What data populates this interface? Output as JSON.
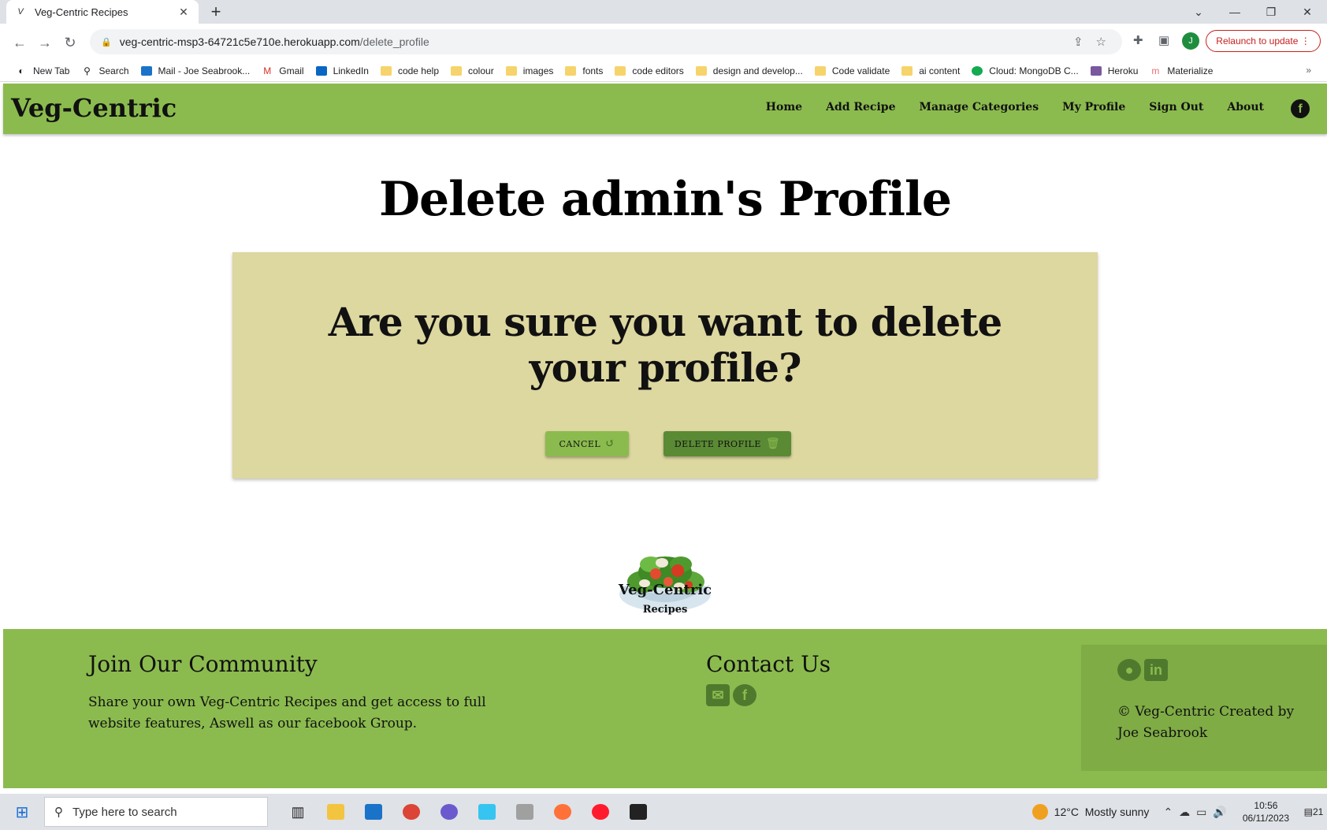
{
  "browser": {
    "tab_title": "Veg-Centric Recipes",
    "tab_favicon": "V",
    "url_host": "veg-centric-msp3-64721c5e710e.herokuapp.com",
    "url_path": "/delete_profile",
    "profile_initial": "J",
    "relaunch_label": "Relaunch to update",
    "bookmarks": [
      {
        "label": "New Tab",
        "icon": "globe-icon"
      },
      {
        "label": "Search",
        "icon": "search-icon"
      },
      {
        "label": "Mail - Joe Seabrook...",
        "icon": "outlook-icon"
      },
      {
        "label": "Gmail",
        "icon": "gmail-icon"
      },
      {
        "label": "LinkedIn",
        "icon": "linkedin-icon"
      },
      {
        "label": "code help",
        "icon": "folder-icon"
      },
      {
        "label": "colour",
        "icon": "folder-icon"
      },
      {
        "label": "images",
        "icon": "folder-icon"
      },
      {
        "label": "fonts",
        "icon": "folder-icon"
      },
      {
        "label": "code editors",
        "icon": "folder-icon"
      },
      {
        "label": "design and develop...",
        "icon": "folder-icon"
      },
      {
        "label": "Code validate",
        "icon": "folder-icon"
      },
      {
        "label": "ai content",
        "icon": "folder-icon"
      },
      {
        "label": "Cloud: MongoDB C...",
        "icon": "mongodb-icon"
      },
      {
        "label": "Heroku",
        "icon": "heroku-icon"
      },
      {
        "label": "Materialize",
        "icon": "materialize-icon"
      }
    ]
  },
  "site": {
    "brand": "Veg-Centric",
    "nav": [
      "Home",
      "Add Recipe",
      "Manage Categories",
      "My Profile",
      "Sign Out",
      "About"
    ],
    "page_title": "Delete admin's Profile",
    "confirm_question": "Are you sure you want to delete your profile?",
    "cancel_label": "CANCEL",
    "delete_label": "DELETE PROFILE",
    "logo_title": "Veg-Centric",
    "logo_subtitle": "Recipes",
    "footer": {
      "community_heading": "Join Our Community",
      "community_text": "Share your own Veg-Centric Recipes and get access to full website features, Aswell as our facebook Group.",
      "contact_heading": "Contact Us",
      "copyright": "© Veg-Centric Created by Joe Seabrook"
    },
    "colors": {
      "nav_bg": "#8bbb4e",
      "card_bg": "#ddd7a0",
      "delete_btn": "#5a8a34"
    }
  },
  "taskbar": {
    "search_placeholder": "Type here to search",
    "weather_temp": "12°C",
    "weather_text": "Mostly sunny",
    "time": "10:56",
    "date": "06/11/2023",
    "notifications": "21"
  }
}
